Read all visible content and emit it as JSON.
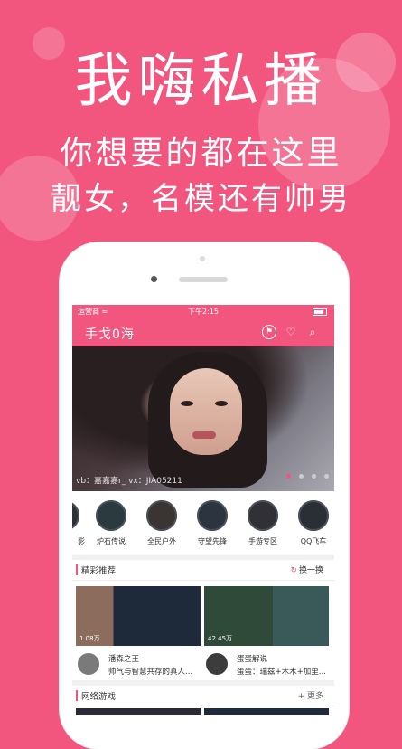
{
  "headline": {
    "title": "我嗨私播",
    "line1": "你想要的都在这里",
    "line2": "靓女，名模还有帅男"
  },
  "status_bar": {
    "carrier": "运营商 ≈",
    "time": "下午2:15"
  },
  "app": {
    "logo": "手戈0海",
    "icons": [
      "badge-icon",
      "heart-icon",
      "search-icon"
    ]
  },
  "banner": {
    "caption": "vb：嘉嘉嘉r_    vx：JIA05211",
    "dots": 4,
    "active_dot": 0
  },
  "categories": [
    {
      "label": "影"
    },
    {
      "label": "炉石传说"
    },
    {
      "label": "全民户外"
    },
    {
      "label": "守望先锋"
    },
    {
      "label": "手游专区"
    },
    {
      "label": "QQ飞车"
    }
  ],
  "section_featured": {
    "title": "精彩推荐",
    "action": "换一换",
    "cards": [
      {
        "views": "1.08万",
        "name": "潘森之王",
        "desc": "帅气与智慧共存的真人..."
      },
      {
        "views": "42.45万",
        "name": "蛋蛋解说",
        "desc": "蛋蛋：瑞兹+木木+加里..."
      }
    ]
  },
  "section_games": {
    "title": "网络游戏",
    "action": "+ 更多"
  },
  "colors": {
    "brand": "#f2567f",
    "text": "#333333"
  }
}
